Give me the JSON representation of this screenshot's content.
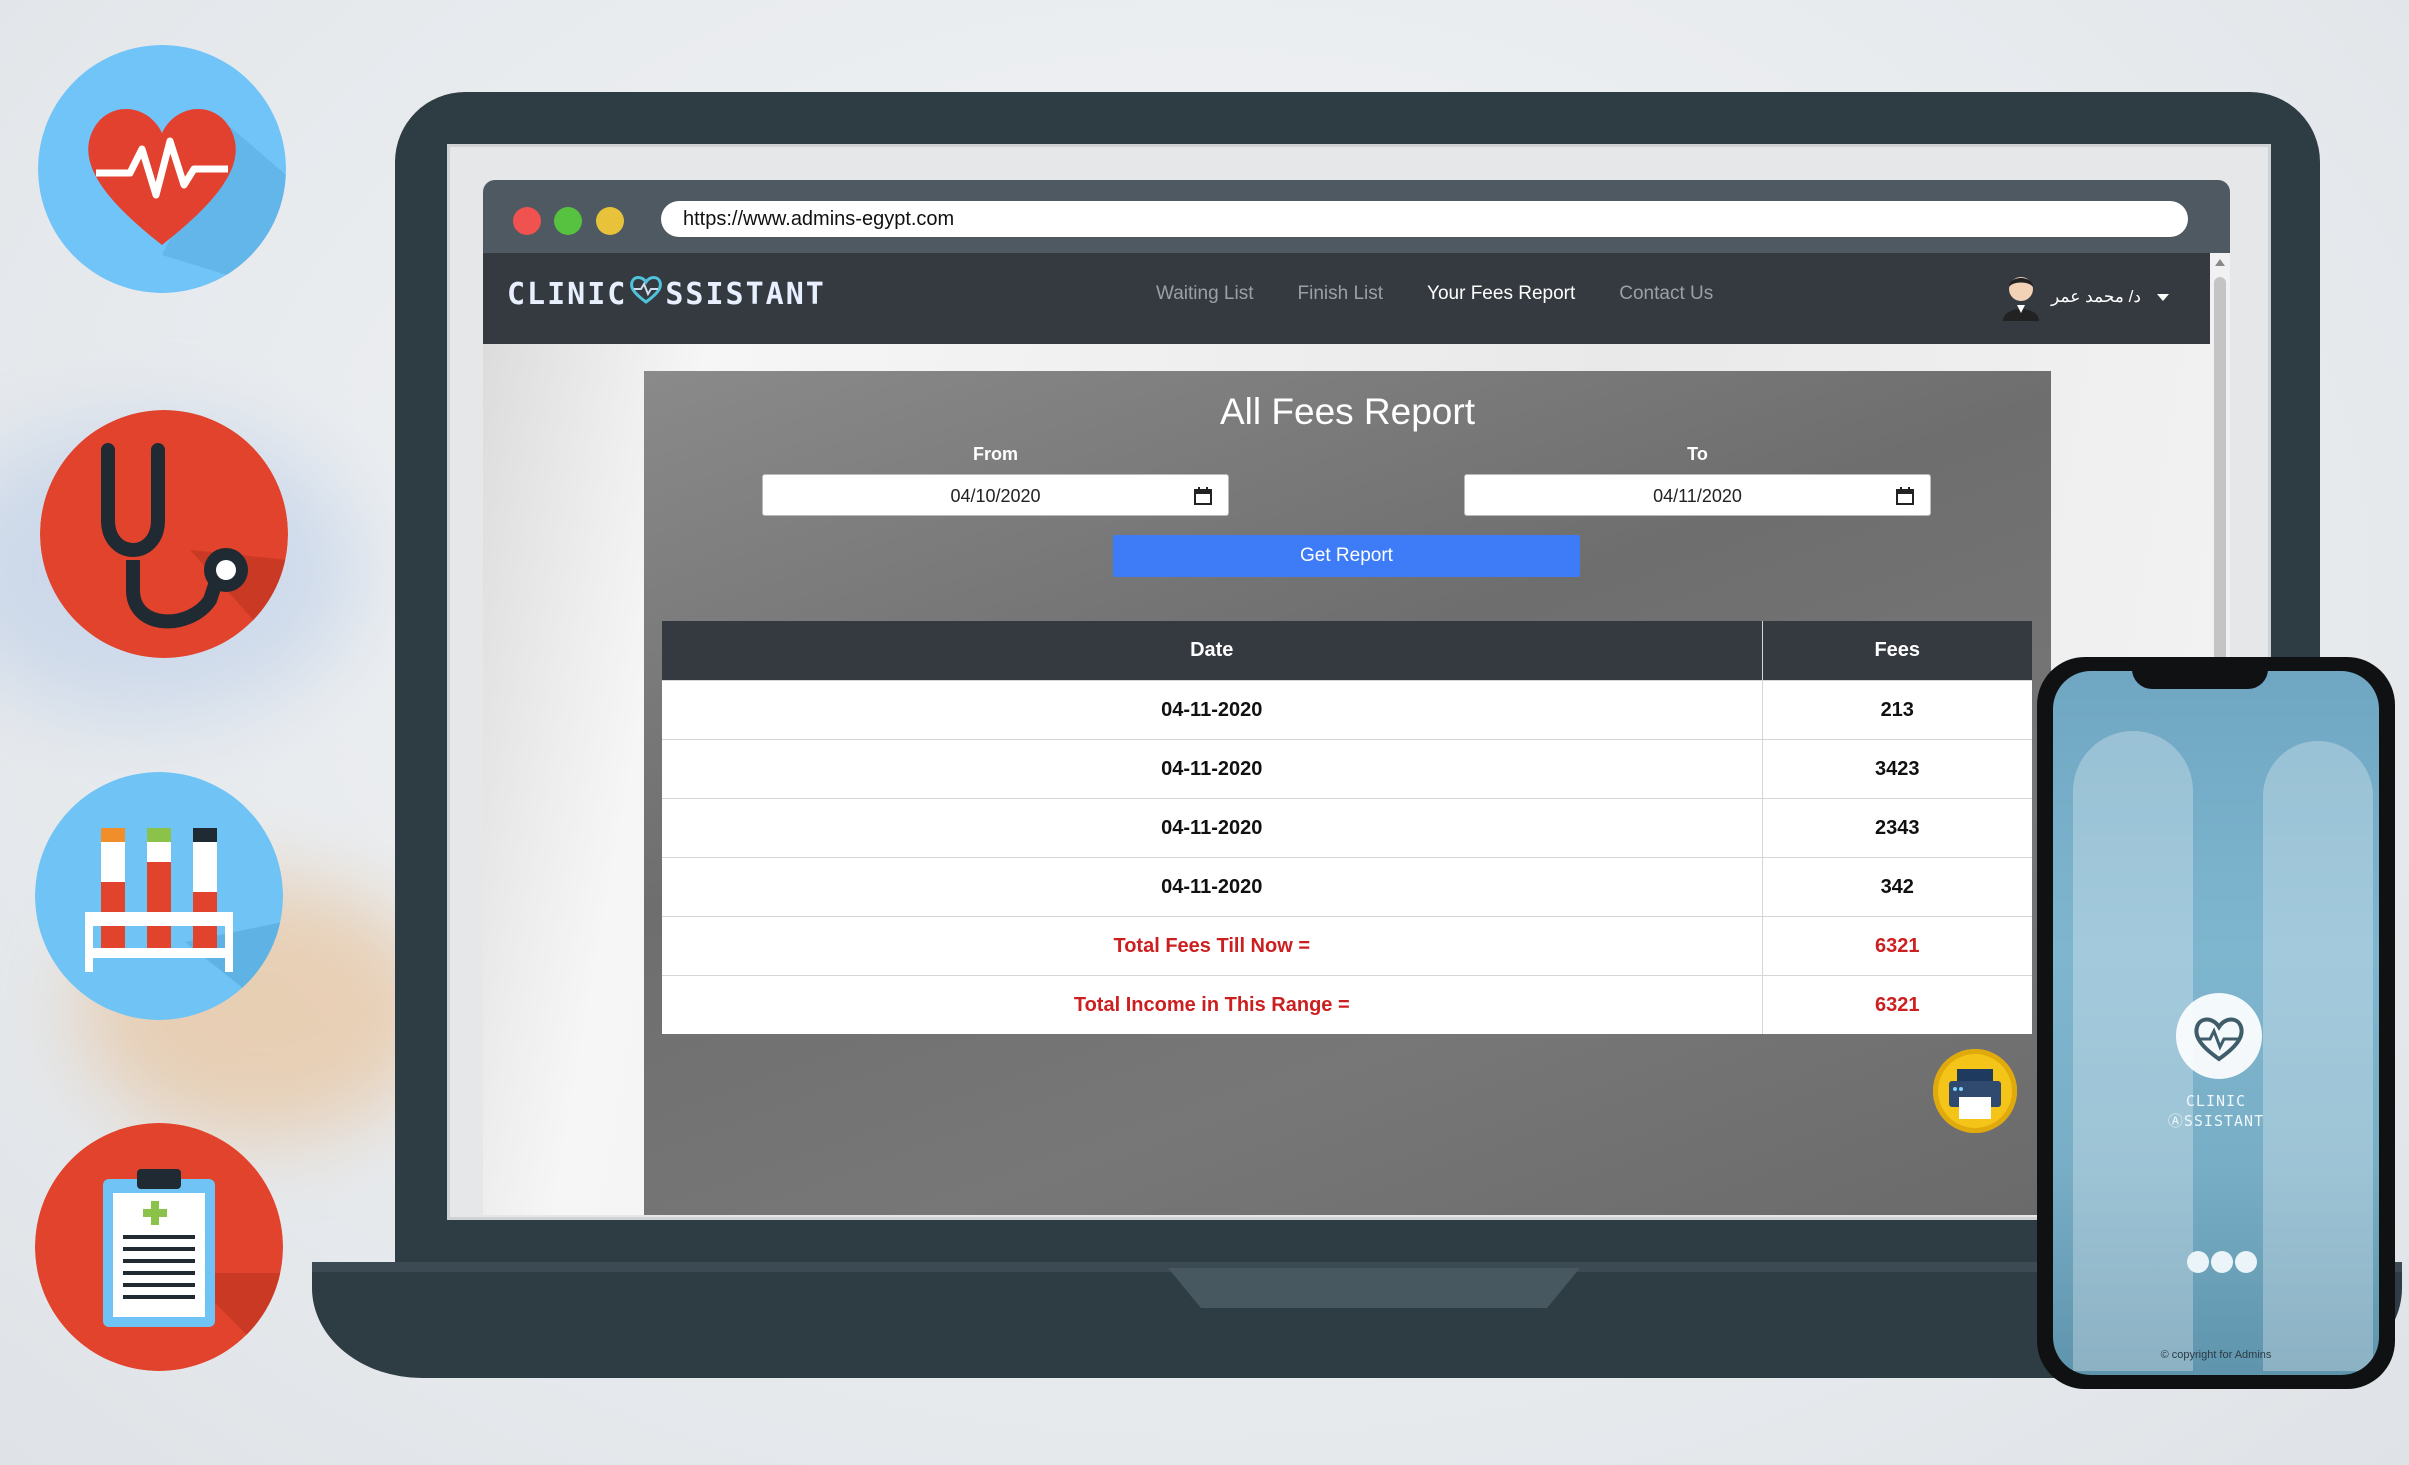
{
  "browser": {
    "url": "https://www.admins-egypt.com"
  },
  "navbar": {
    "brand_left": "CLINIC",
    "brand_right": "SSISTANT",
    "links": [
      {
        "label": "Waiting List"
      },
      {
        "label": "Finish List"
      },
      {
        "label": "Your Fees Report"
      },
      {
        "label": "Contact Us"
      }
    ],
    "user_name": "د/ محمد عمر"
  },
  "report": {
    "title": "All Fees Report",
    "from_label": "From",
    "to_label": "To",
    "from_value": "04/10/2020",
    "to_value": "04/11/2020",
    "get_report_label": "Get Report",
    "table": {
      "headers": [
        "Date",
        "Fees"
      ],
      "rows": [
        [
          "04-11-2020",
          "213"
        ],
        [
          "04-11-2020",
          "3423"
        ],
        [
          "04-11-2020",
          "2343"
        ],
        [
          "04-11-2020",
          "342"
        ]
      ],
      "total_fees_label": "Total Fees Till Now =",
      "total_fees_value": "6321",
      "total_income_label": "Total Income in This Range =",
      "total_income_value": "6321"
    }
  },
  "phone": {
    "brand_line1": "CLINIC",
    "brand_line2": "ⒶSSISTANT",
    "copyright": "© copyright for Admins"
  },
  "colors": {
    "navbar": "#343a40",
    "accent_button": "#3d7bf7",
    "total_red": "#cc1f1f",
    "print_button": "#f4c518"
  },
  "icons": [
    "heart-pulse-icon",
    "stethoscope-icon",
    "test-tubes-icon",
    "clipboard-icon",
    "calendar-icon",
    "printer-icon",
    "user-avatar-icon"
  ]
}
